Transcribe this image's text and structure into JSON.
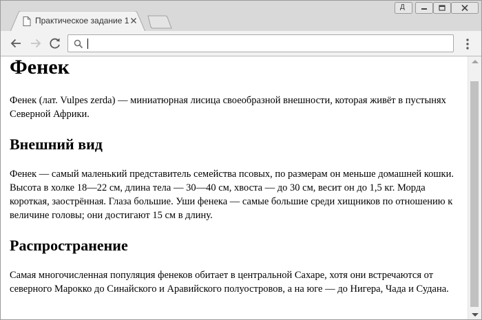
{
  "browser": {
    "tab_title": "Практическое задание 1",
    "url": "",
    "profile_label": "Д"
  },
  "article": {
    "title": "Фенек",
    "intro": "Фенек (лат. Vulpes zerda) — миниатюрная лисица своеобразной внешности, которая живёт в пустынях Северной Африки.",
    "sections": [
      {
        "heading": "Внешний вид",
        "text": "Фенек — самый маленький представитель семейства псовых, по размерам он меньше домашней кошки. Высота в холке 18—22 см, длина тела — 30—40 см, хвоста — до 30 см, весит он до 1,5 кг. Морда короткая, заострённая. Глаза большие. Уши фенека — самые большие среди хищников по отношению к величине головы; они достигают 15 см в длину."
      },
      {
        "heading": "Распространение",
        "text": "Самая многочисленная популяция фенеков обитает в центральной Сахаре, хотя они встречаются от северного Марокко до Синайского и Аравийского полуостровов, а на юге — до Нигера, Чада и Судана."
      }
    ]
  }
}
